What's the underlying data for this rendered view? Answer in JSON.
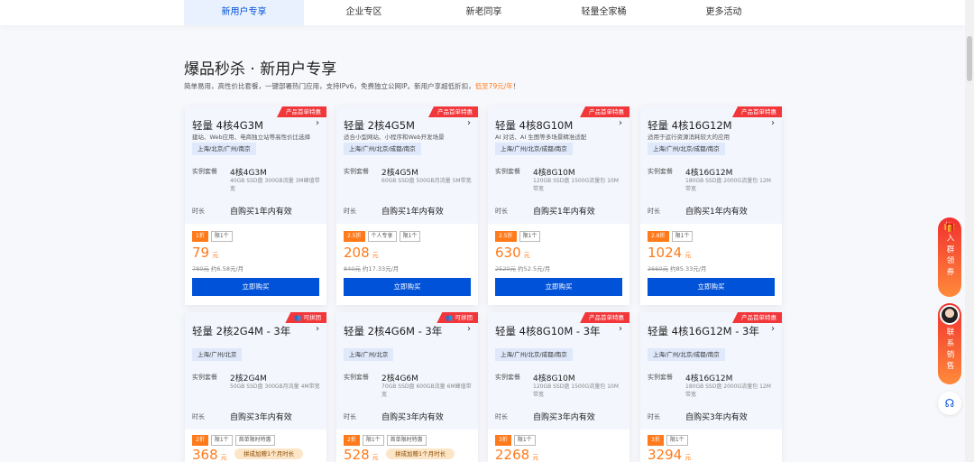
{
  "nav": {
    "tabs": [
      {
        "label": "新用户专享",
        "active": true
      },
      {
        "label": "企业专区"
      },
      {
        "label": "新老同享"
      },
      {
        "label": "轻量全家桶"
      },
      {
        "label": "更多活动"
      }
    ]
  },
  "header": {
    "title": "爆品秒杀 · 新用户专享",
    "subtitle": "简单易用，高性价比套餐，一键部署热门应用，支持IPv6，免费独立公网IP。新用户享超低折扣，",
    "subtitle_highlight": "低至79元/年",
    "subtitle_end": "！"
  },
  "labels": {
    "spec": "实例套餐",
    "duration": "时长",
    "unit": "元",
    "buy": "立即购买"
  },
  "cards": [
    {
      "ribbon": "产品首单特惠",
      "name": "轻量 4核4G3M",
      "desc": "建站、Web应用、电商独立站等高性价比选择",
      "region": "上海/北京/广州/南京",
      "spec": "4核4G3M",
      "spec_detail": "40GB SSD盘 300GB流量 3M峰值带宽",
      "duration": "自购买1年内有效",
      "tags": [
        "1折",
        "限1个"
      ],
      "price": "79",
      "old": "780元",
      "monthly": "约6.58元/月"
    },
    {
      "ribbon": "产品首单特惠",
      "name": "轻量 2核4G5M",
      "desc": "适合小型网站、小程序和Web开发场景",
      "region": "上海/广州/北京/成都/南京",
      "spec": "2核4G5M",
      "spec_detail": "60GB SSD盘 500GB月流量 5M带宽",
      "duration": "自购买1年内有效",
      "tags": [
        "2.5折",
        "个人专享",
        "限1个"
      ],
      "price": "208",
      "old": "840元",
      "monthly": "约17.33元/月"
    },
    {
      "ribbon": "产品首单特惠",
      "name": "轻量 4核8G10M",
      "desc": "AI 对话、AI 生图等多场景精准适配",
      "region": "上海/广州/北京/成都/南京",
      "spec": "4核8G10M",
      "spec_detail": "120GB SSD盘 1500G流量包 10M带宽",
      "duration": "自购买1年内有效",
      "tags": [
        "2.5折",
        "限1个"
      ],
      "price": "630",
      "old": "2520元",
      "monthly": "约52.5元/月"
    },
    {
      "ribbon": "产品首单特惠",
      "name": "轻量 4核16G12M",
      "desc": "适用于运行资源消耗较大的应用",
      "region": "上海/广州/北京/成都/南京",
      "spec": "4核16G12M",
      "spec_detail": "180GB SSD盘 2000G流量包 12M带宽",
      "duration": "自购买1年内有效",
      "tags": [
        "2.8折",
        "限1个"
      ],
      "price": "1024",
      "old": "3660元",
      "monthly": "约85.33元/月"
    },
    {
      "ribbon": "可拼团",
      "name": "轻量 2核2G4M - 3年",
      "region": "上海/广州/北京",
      "spec": "2核2G4M",
      "spec_detail": "50GB SSD盘 300GB月流量 4M带宽",
      "duration": "自购买3年内有效",
      "tags": [
        "2折",
        "限1个",
        "首单限时特惠"
      ],
      "price": "368",
      "group": "拼成加赠1个月时长"
    },
    {
      "ribbon": "可拼团",
      "name": "轻量 2核4G6M - 3年",
      "region": "上海/广州/北京",
      "spec": "2核4G6M",
      "spec_detail": "70GB SSD盘 600GB流量 6M峰值带宽",
      "duration": "自购买3年内有效",
      "tags": [
        "2折",
        "限1个",
        "首单限时特惠"
      ],
      "price": "528",
      "group": "拼成加赠1个月时长"
    },
    {
      "ribbon": "产品首单特惠",
      "name": "轻量 4核8G10M - 3年",
      "region": "上海/广州/北京/成都/南京",
      "spec": "4核8G10M",
      "spec_detail": "120GB SSD盘 1500G流量包 10M带宽",
      "duration": "自购买3年内有效",
      "tags": [
        "3折",
        "限1个"
      ],
      "price": "2268"
    },
    {
      "ribbon": "产品首单特惠",
      "name": "轻量 4核16G12M - 3年",
      "region": "上海/广州/北京/成都/南京",
      "spec": "4核16G12M",
      "spec_detail": "180GB SSD盘 2000G流量包 12M带宽",
      "duration": "自购买3年内有效",
      "tags": [
        "3折",
        "限1个"
      ],
      "price": "3294"
    }
  ],
  "side": {
    "coupon": "入群领券",
    "sales": "联系销售"
  },
  "colors": {
    "accent": "#0052d9",
    "price": "#ff7a1a",
    "ribbon": "#f2373b"
  }
}
